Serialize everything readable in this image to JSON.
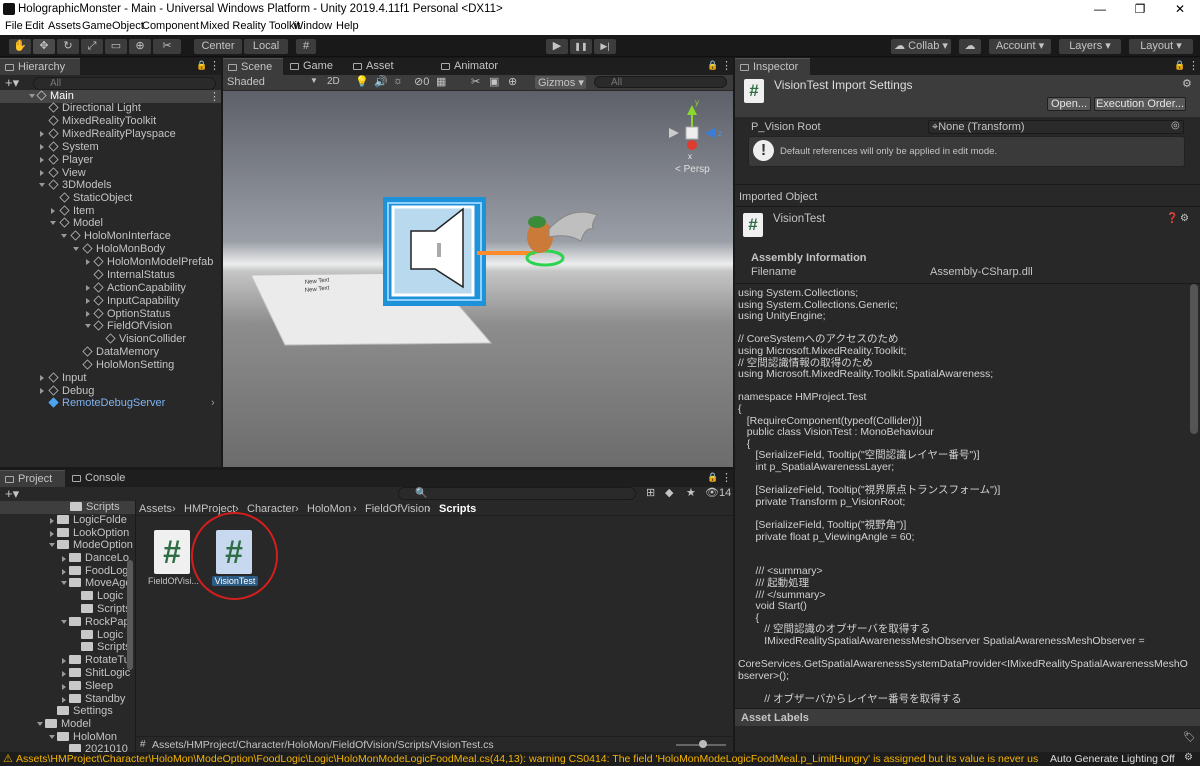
{
  "window": {
    "title": "HolographicMonster - Main - Universal Windows Platform - Unity 2019.4.11f1 Personal <DX11>",
    "min": "—",
    "max": "❐",
    "close": "✕"
  },
  "menu": [
    "File",
    "Edit",
    "Assets",
    "GameObject",
    "Component",
    "Mixed Reality Toolkit",
    "Window",
    "Help"
  ],
  "toolbar": {
    "center": "Center",
    "local": "Local",
    "collab": "Collab",
    "account": "Account",
    "layers": "Layers",
    "layout": "Layout",
    "play": "▶",
    "pause": "❚❚",
    "step": "▶|"
  },
  "hierarchy": {
    "tab": "Hierarchy",
    "search_placeholder": "All",
    "items": [
      {
        "label": "Main"
      },
      {
        "label": "Directional Light"
      },
      {
        "label": "MixedRealityToolkit"
      },
      {
        "label": "MixedRealityPlayspace"
      },
      {
        "label": "System"
      },
      {
        "label": "Player"
      },
      {
        "label": "View"
      },
      {
        "label": "3DModels"
      },
      {
        "label": "StaticObject"
      },
      {
        "label": "Item"
      },
      {
        "label": "Model"
      },
      {
        "label": "HoloMonInterface"
      },
      {
        "label": "HoloMonBody"
      },
      {
        "label": "HoloMonModelPrefab"
      },
      {
        "label": "InternalStatus"
      },
      {
        "label": "ActionCapability"
      },
      {
        "label": "InputCapability"
      },
      {
        "label": "OptionStatus"
      },
      {
        "label": "FieldOfVision"
      },
      {
        "label": "VisionCollider"
      },
      {
        "label": "DataMemory"
      },
      {
        "label": "HoloMonSetting"
      },
      {
        "label": "Input"
      },
      {
        "label": "Debug"
      },
      {
        "label": "RemoteDebugServer"
      }
    ]
  },
  "scene": {
    "tabs": [
      "Scene",
      "Game",
      "Asset Store",
      "Animator"
    ],
    "shading": "Shaded",
    "mode2d": "2D",
    "gizmos": "Gizmos",
    "search_placeholder": "All",
    "persp": "< Persp",
    "layercount": "0",
    "newtext1": "New Text",
    "newtext2": "New Text"
  },
  "project": {
    "tabs": [
      "Project",
      "Console"
    ],
    "breadcrumb": [
      "Assets",
      "HMProject",
      "Character",
      "HoloMon",
      "FieldOfVision",
      "Scripts"
    ],
    "tree": [
      {
        "label": "Scripts"
      },
      {
        "label": "LogicFolde"
      },
      {
        "label": "LookOption"
      },
      {
        "label": "ModeOption"
      },
      {
        "label": "DanceLo"
      },
      {
        "label": "FoodLogi"
      },
      {
        "label": "MoveAge"
      },
      {
        "label": "Logic"
      },
      {
        "label": "Scripts"
      },
      {
        "label": "RockPap"
      },
      {
        "label": "Logic"
      },
      {
        "label": "Scripts"
      },
      {
        "label": "RotateTu"
      },
      {
        "label": "ShitLogic"
      },
      {
        "label": "Sleep"
      },
      {
        "label": "Standby"
      },
      {
        "label": "Settings"
      },
      {
        "label": "Model"
      },
      {
        "label": "HoloMon"
      },
      {
        "label": "2021010"
      }
    ],
    "files": [
      {
        "label": "FieldOfVisi..."
      },
      {
        "label": "VisionTest"
      }
    ],
    "path": "Assets/HMProject/Character/HoloMon/FieldOfVision/Scripts/VisionTest.cs",
    "count": "14"
  },
  "inspector": {
    "tab": "Inspector",
    "title": "VisionTest Import Settings",
    "open": "Open...",
    "exec": "Execution Order...",
    "field_label": "P_Vision Root",
    "field_value": "None (Transform)",
    "help": "Default references will only be applied in edit mode.",
    "imported": "Imported Object",
    "obj_name": "VisionTest",
    "asm_header": "Assembly Information",
    "filename_label": "Filename",
    "filename_value": "Assembly-CSharp.dll",
    "labels": "Asset Labels",
    "code": [
      "using System.Collections;",
      "using System.Collections.Generic;",
      "using UnityEngine;",
      "",
      "// CoreSystemへのアクセスのため",
      "using Microsoft.MixedReality.Toolkit;",
      "// 空間認識情報の取得のため",
      "using Microsoft.MixedReality.Toolkit.SpatialAwareness;",
      "",
      "namespace HMProject.Test",
      "{",
      "   [RequireComponent(typeof(Collider))]",
      "   public class VisionTest : MonoBehaviour",
      "   {",
      "      [SerializeField, Tooltip(\"空間認識レイヤー番号\")]",
      "      int p_SpatialAwarenessLayer;",
      "",
      "      [SerializeField, Tooltip(\"視界原点トランスフォーム\")]",
      "      private Transform p_VisionRoot;",
      "",
      "      [SerializeField, Tooltip(\"視野角\")]",
      "      private float p_ViewingAngle = 60;",
      "",
      "",
      "      /// <summary>",
      "      /// 起動処理",
      "      /// </summary>",
      "      void Start()",
      "      {",
      "         // 空間認識のオブザーバを取得する",
      "         IMixedRealitySpatialAwarenessMeshObserver SpatialAwarenessMeshObserver =",
      "",
      "CoreServices.GetSpatialAwarenessSystemDataProvider<IMixedRealitySpatialAwarenessMeshO",
      "bserver>();",
      "",
      "         // オブザーバからレイヤー番号を取得する"
    ]
  },
  "status": {
    "warning": "Assets\\HMProject\\Character\\HoloMon\\ModeOption\\FoodLogic\\Logic\\HoloMonModeLogicFoodMeal.cs(44,13): warning CS0414: The field 'HoloMonModeLogicFoodMeal.p_LimitHungry' is assigned but its value is never us",
    "lighting": "Auto Generate Lighting Off"
  }
}
